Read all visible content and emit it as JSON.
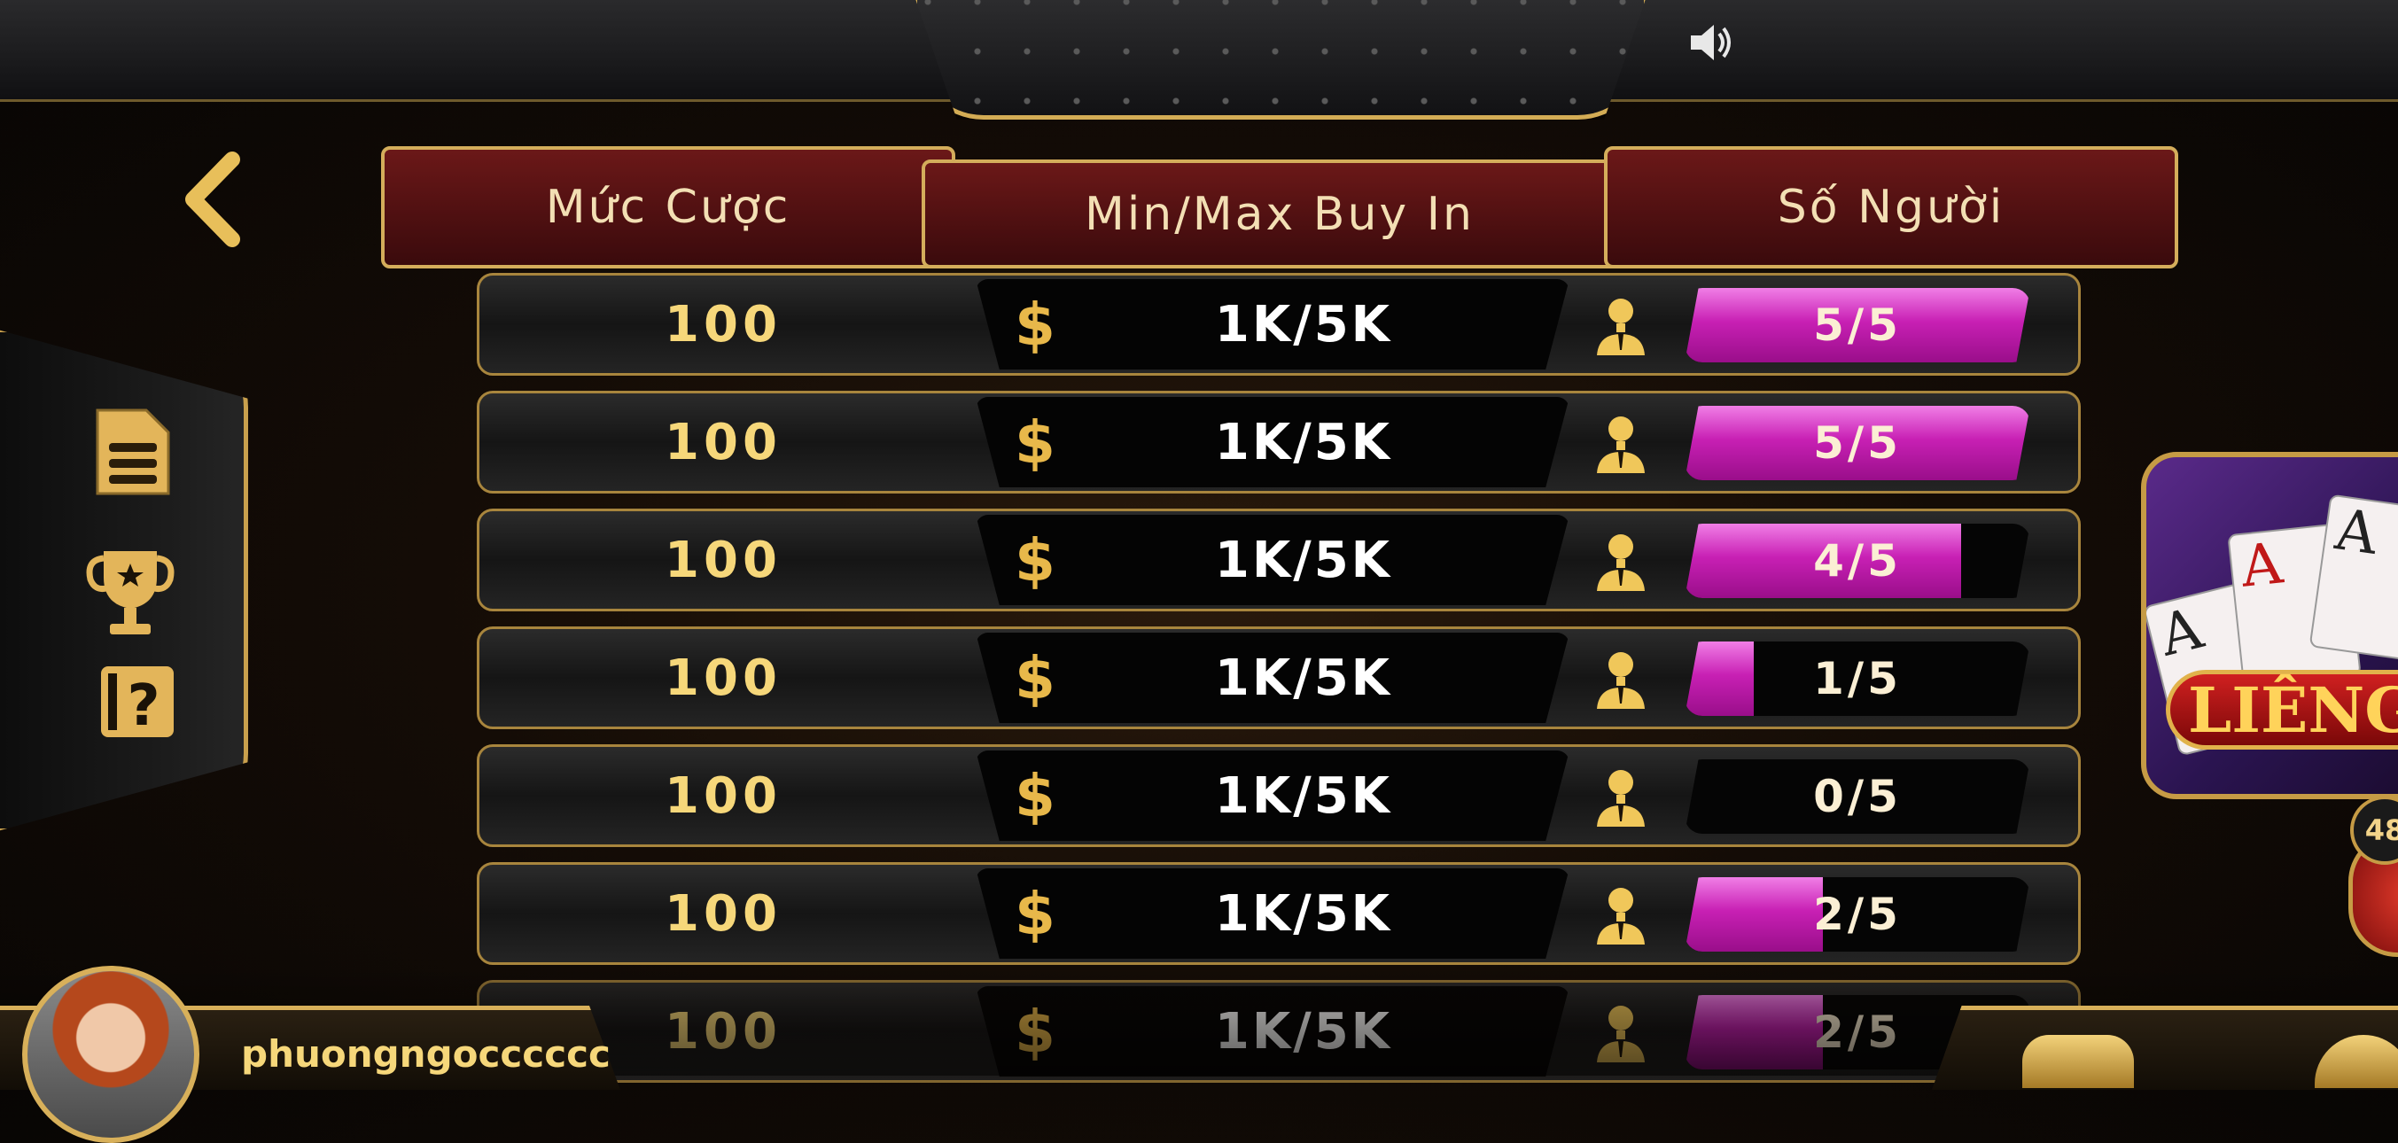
{
  "header": {
    "bet_label": "Mức Cược",
    "buyin_label": "Min/Max Buy In",
    "players_label": "Số Người"
  },
  "tables": [
    {
      "bet": "100",
      "buyin": "1K/5K",
      "players": "5/5",
      "fill": 1.0
    },
    {
      "bet": "100",
      "buyin": "1K/5K",
      "players": "5/5",
      "fill": 1.0
    },
    {
      "bet": "100",
      "buyin": "1K/5K",
      "players": "4/5",
      "fill": 0.8
    },
    {
      "bet": "100",
      "buyin": "1K/5K",
      "players": "1/5",
      "fill": 0.2
    },
    {
      "bet": "100",
      "buyin": "1K/5K",
      "players": "0/5",
      "fill": 0.0
    },
    {
      "bet": "100",
      "buyin": "1K/5K",
      "players": "2/5",
      "fill": 0.4
    },
    {
      "bet": "100",
      "buyin": "1K/5K",
      "players": "2/5",
      "fill": 0.4
    }
  ],
  "currency_symbol": "$",
  "game_badge": {
    "title": "LIÊNG",
    "card_rank": "A",
    "online_count": "48"
  },
  "user": {
    "username": "phuongngocccccc"
  },
  "colors": {
    "gold": "#d4ad5b",
    "magenta": "#c820b4",
    "header_red": "#6b1818"
  }
}
